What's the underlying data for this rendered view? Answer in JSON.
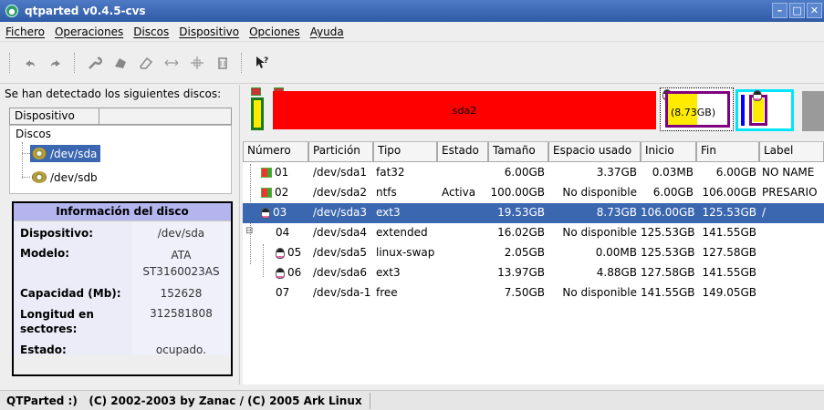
{
  "window": {
    "title": "qtparted v0.4.5-cvs"
  },
  "menu": [
    "Fichero",
    "Operaciones",
    "Discos",
    "Dispositivo",
    "Opciones",
    "Ayuda"
  ],
  "toolbar": {
    "icons": [
      "undo-icon",
      "redo-icon",
      "wrench-icon",
      "disk-icon",
      "eraser-icon",
      "resize-icon",
      "move-icon",
      "trash-icon",
      "help-pointer-icon"
    ]
  },
  "left": {
    "detect_label": "Se han detectado los siguientes discos:",
    "device_header": "Dispositivo",
    "tree_group": "Discos",
    "devices": [
      "/dev/sda",
      "/dev/sdb"
    ],
    "info_title": "Información del disco",
    "info": [
      {
        "k": "Dispositivo:",
        "v": "/dev/sda"
      },
      {
        "k": "Modelo:",
        "v": "ATA ST3160023AS"
      },
      {
        "k": "Capacidad (Mb):",
        "v": "152628"
      },
      {
        "k": "Longitud en sectores:",
        "v": "312581808"
      },
      {
        "k": "Estado:",
        "v": "ocupado."
      }
    ]
  },
  "diskmap": {
    "sda2_label": "sda2",
    "sda3_label": "(8.73GB)"
  },
  "table": {
    "headers": [
      "Número",
      "Partición",
      "Tipo",
      "Estado",
      "Tamaño",
      "Espacio usado",
      "Inicio",
      "Fin",
      "Label"
    ],
    "rows": [
      {
        "num": "01",
        "part": "/dev/sda1",
        "type": "fat32",
        "state": "",
        "size": "6.00GB",
        "used": "3.37GB",
        "start": "0.03MB",
        "end": "6.00GB",
        "label": "NO NAME"
      },
      {
        "num": "02",
        "part": "/dev/sda2",
        "type": "ntfs",
        "state": "Activa",
        "size": "100.00GB",
        "used": "No disponible",
        "start": "6.00GB",
        "end": "106.00GB",
        "label": "PRESARIO"
      },
      {
        "num": "03",
        "part": "/dev/sda3",
        "type": "ext3",
        "state": "",
        "size": "19.53GB",
        "used": "8.73GB",
        "start": "106.00GB",
        "end": "125.53GB",
        "label": "/"
      },
      {
        "num": "04",
        "part": "/dev/sda4",
        "type": "extended",
        "state": "",
        "size": "16.02GB",
        "used": "No disponible",
        "start": "125.53GB",
        "end": "141.55GB",
        "label": ""
      },
      {
        "num": "05",
        "part": "/dev/sda5",
        "type": "linux-swap",
        "state": "",
        "size": "2.05GB",
        "used": "0.00MB",
        "start": "125.53GB",
        "end": "127.58GB",
        "label": ""
      },
      {
        "num": "06",
        "part": "/dev/sda6",
        "type": "ext3",
        "state": "",
        "size": "13.97GB",
        "used": "4.88GB",
        "start": "127.58GB",
        "end": "141.55GB",
        "label": ""
      },
      {
        "num": "07",
        "part": "/dev/sda-1",
        "type": "free",
        "state": "",
        "size": "7.50GB",
        "used": "No disponible",
        "start": "141.55GB",
        "end": "149.05GB",
        "label": ""
      }
    ]
  },
  "status": "QTParted :)   (C) 2002-2003 by Zanac / (C) 2005 Ark Linux"
}
